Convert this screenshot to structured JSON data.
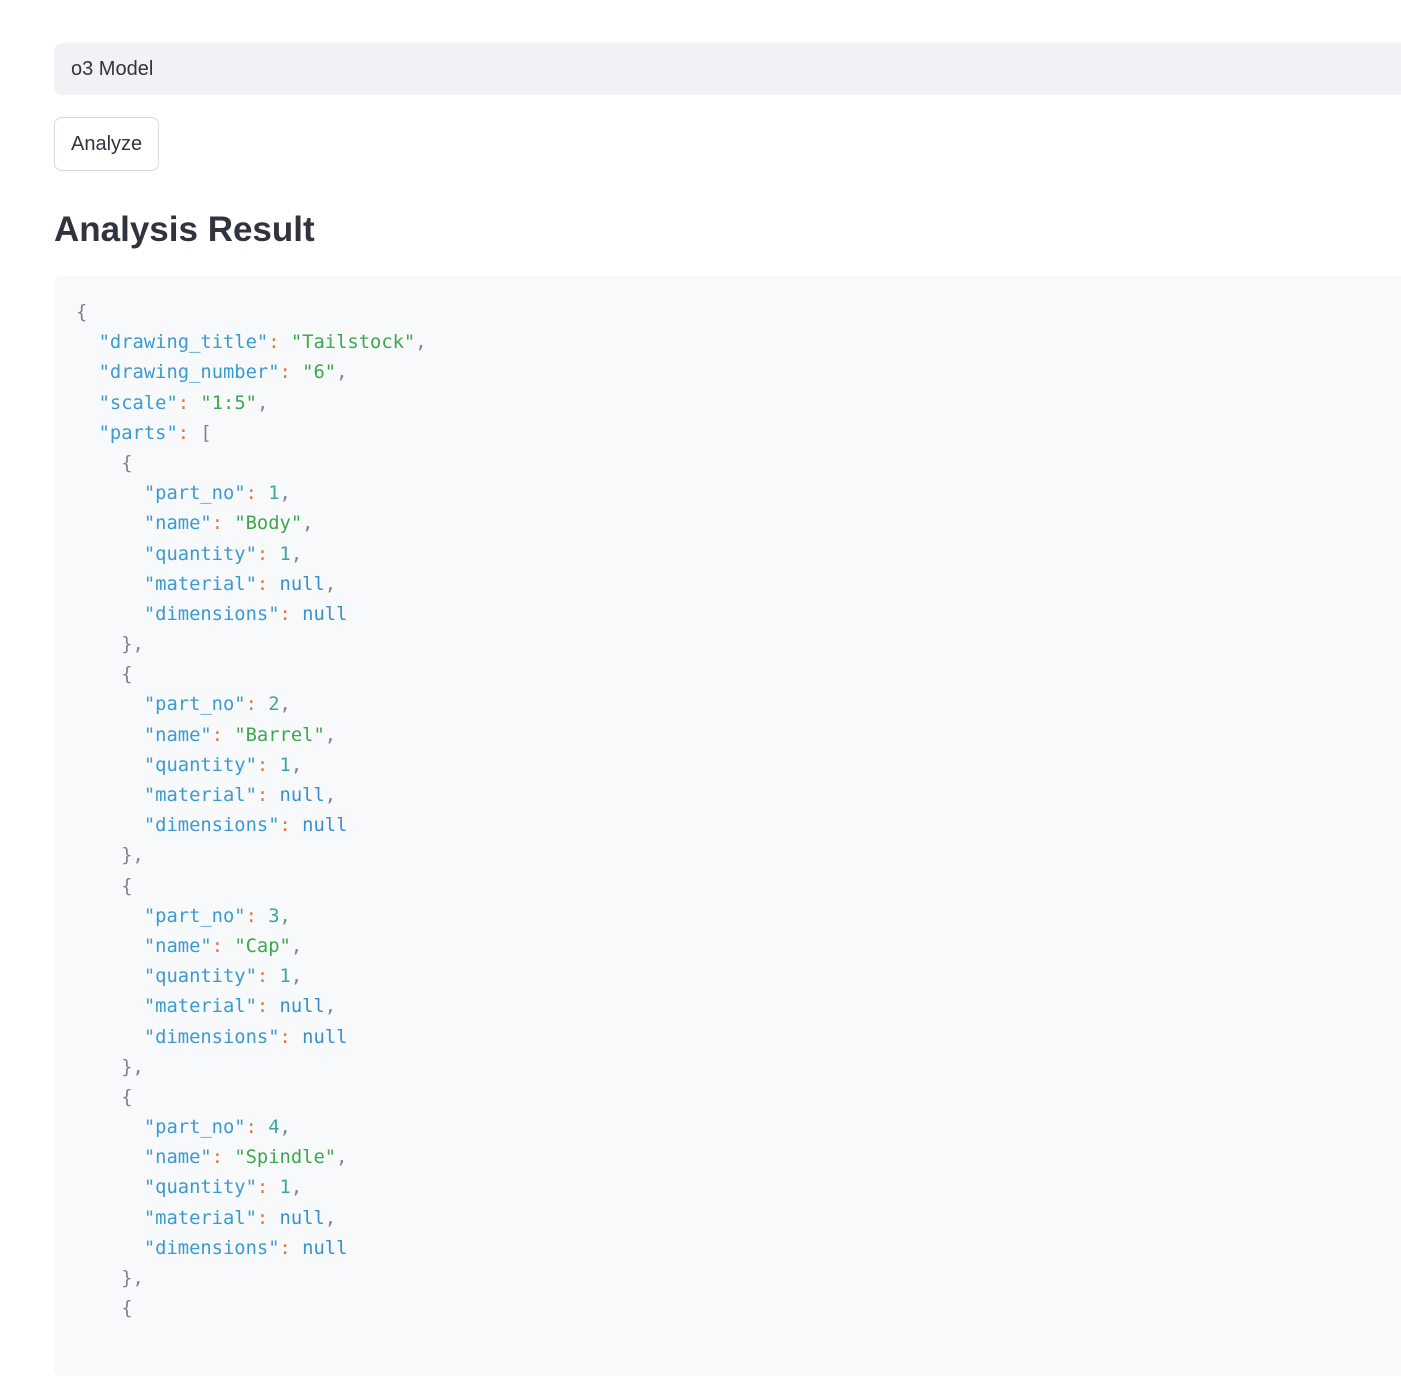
{
  "model_select": {
    "value": "o3 Model"
  },
  "analyze_button": {
    "label": "Analyze"
  },
  "result_heading": "Analysis Result",
  "colors": {
    "key": "#3b9bd0",
    "string": "#3fa64e",
    "number": "#3aa7a3",
    "null": "#3b8fd0",
    "colon": "#e2793a",
    "punctuation": "#7d828b"
  },
  "result": {
    "drawing_title": "Tailstock",
    "drawing_number": "6",
    "scale": "1:5",
    "parts": [
      {
        "part_no": 1,
        "name": "Body",
        "quantity": 1,
        "material": null,
        "dimensions": null
      },
      {
        "part_no": 2,
        "name": "Barrel",
        "quantity": 1,
        "material": null,
        "dimensions": null
      },
      {
        "part_no": 3,
        "name": "Cap",
        "quantity": 1,
        "material": null,
        "dimensions": null
      },
      {
        "part_no": 4,
        "name": "Spindle",
        "quantity": 1,
        "material": null,
        "dimensions": null
      }
    ]
  }
}
